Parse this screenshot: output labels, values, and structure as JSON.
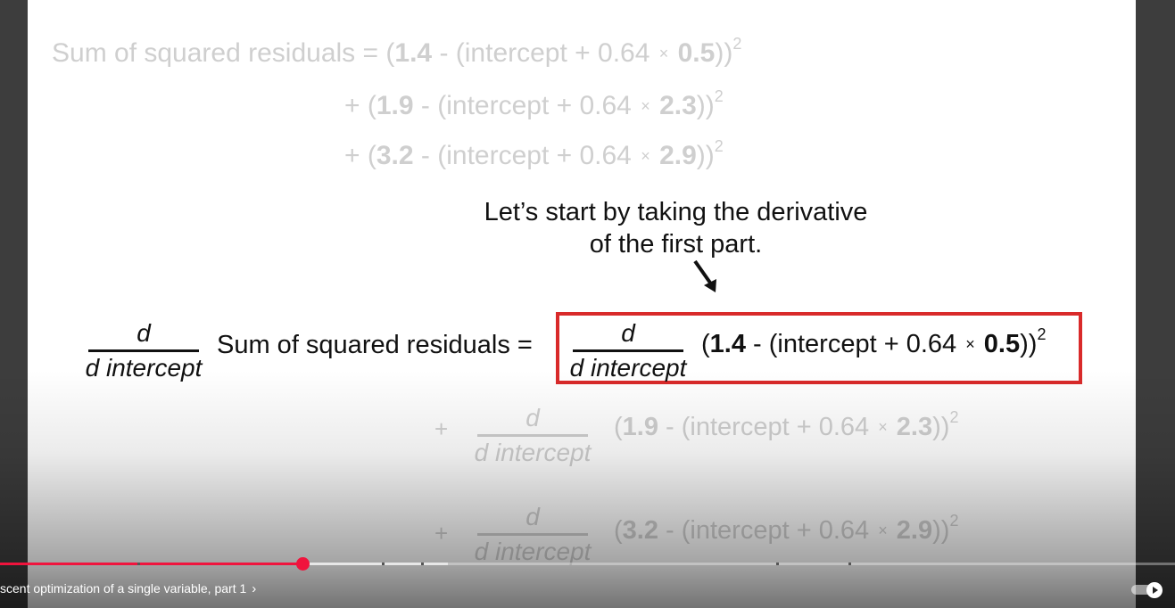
{
  "slide": {
    "top_equation": {
      "label": "Sum of squared residuals =",
      "line1": {
        "open": "(",
        "obs": "1.4",
        "mid": " - (intercept + 0.64 ",
        "times": "×",
        "x": "0.5",
        "close": "))",
        "exp": "2"
      },
      "line2": {
        "open": "+ (",
        "obs": "1.9",
        "mid": " - (intercept + 0.64 ",
        "times": "×",
        "x": "2.3",
        "close": "))",
        "exp": "2"
      },
      "line3": {
        "open": "+ (",
        "obs": "3.2",
        "mid": " - (intercept + 0.64 ",
        "times": "×",
        "x": "2.9",
        "close": "))",
        "exp": "2"
      }
    },
    "note": {
      "line1": "Let’s start by taking the derivative",
      "line2": "of the first part.",
      "arrow": "↘"
    },
    "derivative": {
      "d": "d",
      "d_intercept": "d intercept",
      "label": "Sum of squared residuals =",
      "term1": {
        "open": "(",
        "obs": "1.4",
        "mid": " - (intercept + 0.64 ",
        "times": "×",
        "x": "0.5",
        "close": "))",
        "exp": "2"
      },
      "plus": "+",
      "term2": {
        "open": "(",
        "obs": "1.9",
        "mid": " - (intercept + 0.64 ",
        "times": "×",
        "x": "2.3",
        "close": "))",
        "exp": "2"
      },
      "term3": {
        "open": "(",
        "obs": "3.2",
        "mid": " - (intercept + 0.64 ",
        "times": "×",
        "x": "2.9",
        "close": "))",
        "exp": "2"
      }
    },
    "highlight_color": "#d92a2a"
  },
  "player": {
    "progress_fraction": 0.258,
    "accent_color": "#f0143d",
    "chapter_title": "scent optimization of a single variable, part 1",
    "chapter_chevron": "chevron-right-icon",
    "autoplay_icon": "play-icon"
  }
}
